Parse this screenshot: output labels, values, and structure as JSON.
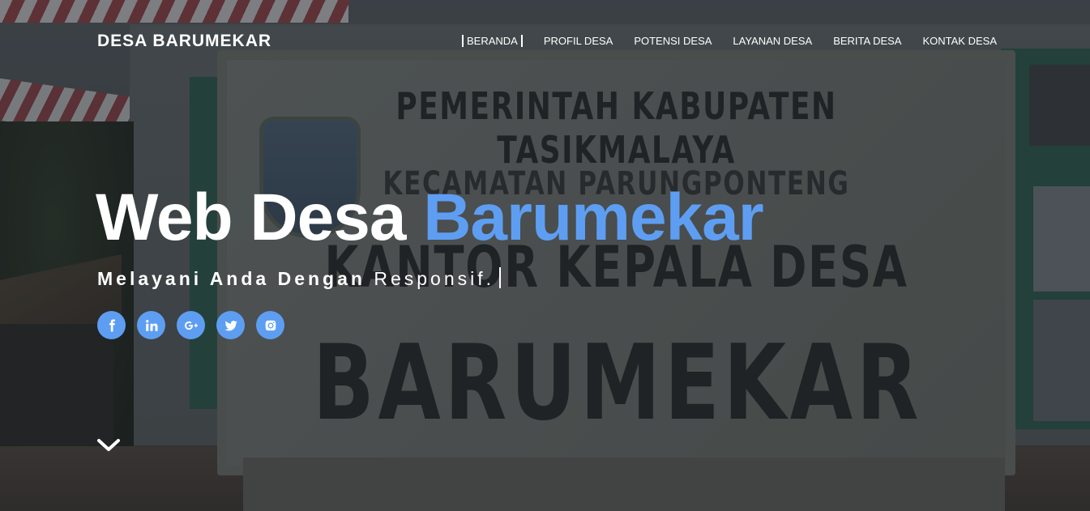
{
  "header": {
    "brand": "DESA BARUMEKAR",
    "nav": [
      "BERANDA",
      "PROFIL DESA",
      "POTENSI DESA",
      "LAYANAN DESA",
      "BERITA DESA",
      "KONTAK DESA"
    ]
  },
  "hero": {
    "title_plain": "Web Desa",
    "title_accent": "Barumekar",
    "subtitle_strong": "Melayani Anda Dengan",
    "subtitle_rest": "Responsif."
  },
  "background_sign": {
    "line1": "PEMERINTAH KABUPATEN TASIKMALAYA",
    "line2": "KECAMATAN PARUNGPONTENG",
    "line3": "KANTOR KEPALA DESA",
    "line4": "BARUMEKAR"
  },
  "socials": [
    "facebook-icon",
    "linkedin-icon",
    "google-plus-icon",
    "twitter-icon",
    "instagram-icon"
  ],
  "colors": {
    "accent": "#5e9ef2",
    "text": "#ffffff"
  }
}
